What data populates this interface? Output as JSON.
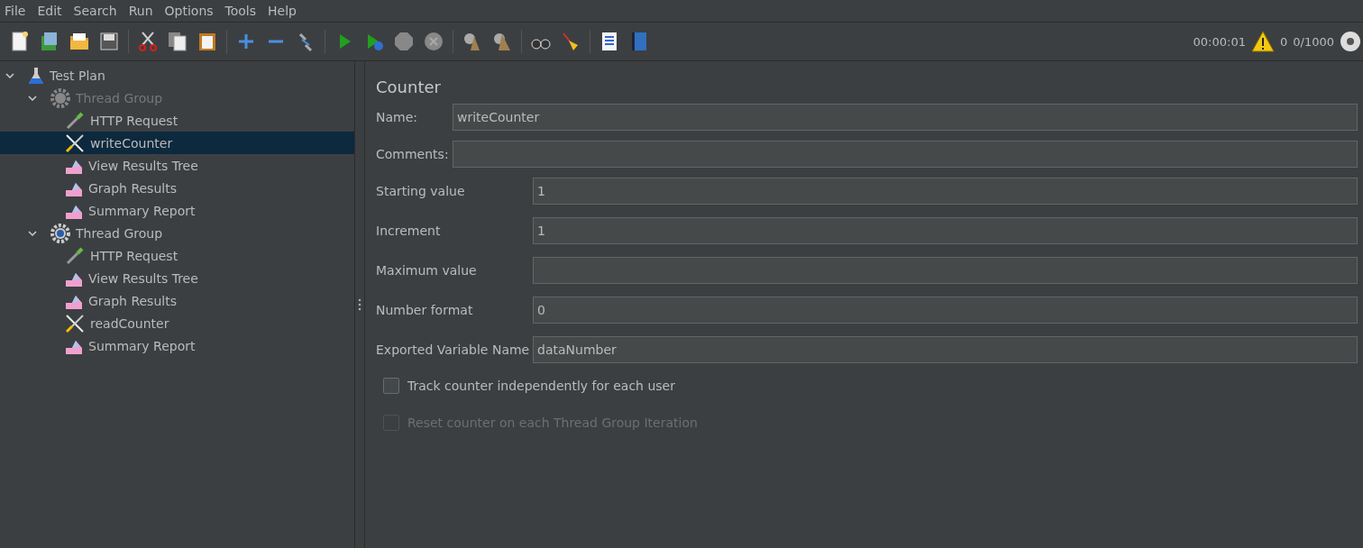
{
  "menu": [
    {
      "label": "File"
    },
    {
      "label": "Edit"
    },
    {
      "label": "Search"
    },
    {
      "label": "Run"
    },
    {
      "label": "Options"
    },
    {
      "label": "Tools"
    },
    {
      "label": "Help"
    }
  ],
  "status": {
    "elapsed": "00:00:01",
    "warnings": "0",
    "threads": "0/1000"
  },
  "tree": [
    {
      "label": "Test Plan",
      "kind": "plan",
      "expanded": true,
      "disabled": false,
      "selected": false,
      "children": [
        {
          "label": "Thread Group",
          "kind": "thread-group",
          "expanded": true,
          "disabled": true,
          "selected": false,
          "children": [
            {
              "label": "HTTP Request",
              "kind": "sampler",
              "disabled": false,
              "selected": false
            },
            {
              "label": "writeCounter",
              "kind": "config",
              "disabled": false,
              "selected": true
            },
            {
              "label": "View Results Tree",
              "kind": "listener",
              "disabled": false,
              "selected": false
            },
            {
              "label": "Graph Results",
              "kind": "listener",
              "disabled": false,
              "selected": false
            },
            {
              "label": "Summary Report",
              "kind": "listener",
              "disabled": false,
              "selected": false
            }
          ]
        },
        {
          "label": "Thread Group",
          "kind": "thread-group",
          "expanded": true,
          "disabled": false,
          "selected": false,
          "children": [
            {
              "label": "HTTP Request",
              "kind": "sampler",
              "disabled": false,
              "selected": false
            },
            {
              "label": "View Results Tree",
              "kind": "listener",
              "disabled": false,
              "selected": false
            },
            {
              "label": "Graph Results",
              "kind": "listener",
              "disabled": false,
              "selected": false
            },
            {
              "label": "readCounter",
              "kind": "config",
              "disabled": false,
              "selected": false
            },
            {
              "label": "Summary Report",
              "kind": "listener",
              "disabled": false,
              "selected": false
            }
          ]
        }
      ]
    }
  ],
  "panel": {
    "title": "Counter",
    "header_fields": [
      {
        "label": "Name:",
        "value": "writeCounter"
      },
      {
        "label": "Comments:"
      }
    ],
    "fields": [
      {
        "label": "Starting value",
        "value": "1"
      },
      {
        "label": "Increment",
        "value": "1"
      },
      {
        "label": "Maximum value"
      },
      {
        "label": "Number format",
        "value": "0"
      },
      {
        "label": "Exported Variable Name",
        "value": "dataNumber"
      }
    ],
    "options": [
      {
        "label": "Track counter independently for each user",
        "checked": false,
        "disabled": false
      },
      {
        "label": "Reset counter on each Thread Group Iteration",
        "checked": false,
        "disabled": true
      }
    ]
  }
}
